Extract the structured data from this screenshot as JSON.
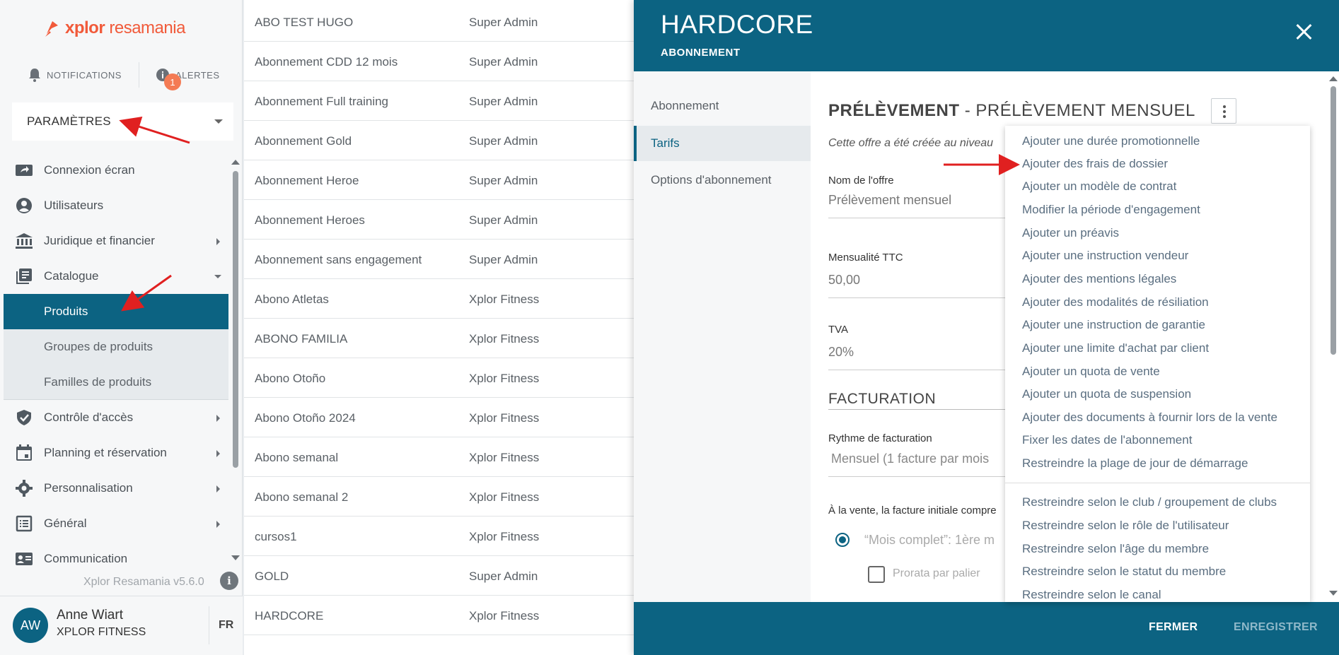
{
  "brand": {
    "name_bold": "xplor",
    "name_rest": " resamania",
    "color": "#f15a3a"
  },
  "header_buttons": {
    "notifications": "NOTIFICATIONS",
    "alerts": "ALERTES",
    "alerts_count": "1"
  },
  "parametres": {
    "label": "PARAMÈTRES"
  },
  "menu": {
    "items": [
      {
        "label": "Connexion écran",
        "icon": "screen-share-icon"
      },
      {
        "label": "Utilisateurs",
        "icon": "user-circle-icon"
      },
      {
        "label": "Juridique et financier",
        "icon": "bank-icon"
      },
      {
        "label": "Catalogue",
        "icon": "catalog-icon"
      },
      {
        "label": "Produits"
      },
      {
        "label": "Groupes de produits"
      },
      {
        "label": "Familles de produits"
      },
      {
        "label": "Contrôle d'accès",
        "icon": "shield-check-icon"
      },
      {
        "label": "Planning et réservation",
        "icon": "calendar-icon"
      },
      {
        "label": "Personnalisation",
        "icon": "gear-icon"
      },
      {
        "label": "Général",
        "icon": "list-icon"
      },
      {
        "label": "Communication",
        "icon": "contact-card-icon"
      }
    ]
  },
  "version": "Xplor Resamania v5.6.0",
  "user": {
    "initials": "AW",
    "name": "Anne Wiart",
    "company": "XPLOR FITNESS",
    "lang": "FR"
  },
  "products": [
    {
      "name": "ABO TEST HUGO",
      "owner": "Super Admin"
    },
    {
      "name": "Abonnement CDD 12 mois",
      "owner": "Super Admin"
    },
    {
      "name": "Abonnement Full training",
      "owner": "Super Admin"
    },
    {
      "name": "Abonnement Gold",
      "owner": "Super Admin"
    },
    {
      "name": "Abonnement Heroe",
      "owner": "Super Admin"
    },
    {
      "name": "Abonnement Heroes",
      "owner": "Super Admin"
    },
    {
      "name": "Abonnement sans engagement",
      "owner": "Super Admin"
    },
    {
      "name": "Abono Atletas",
      "owner": "Xplor Fitness"
    },
    {
      "name": "ABONO FAMILIA",
      "owner": "Xplor Fitness"
    },
    {
      "name": "Abono Otoño",
      "owner": "Xplor Fitness"
    },
    {
      "name": "Abono Otoño 2024",
      "owner": "Xplor Fitness"
    },
    {
      "name": "Abono semanal",
      "owner": "Xplor Fitness"
    },
    {
      "name": "Abono semanal 2",
      "owner": "Xplor Fitness"
    },
    {
      "name": "cursos1",
      "owner": "Xplor Fitness"
    },
    {
      "name": "GOLD",
      "owner": "Super Admin"
    },
    {
      "name": "HARDCORE",
      "owner": "Xplor Fitness"
    }
  ],
  "panel": {
    "title": "HARDCORE",
    "subtitle": "ABONNEMENT",
    "nav": [
      "Abonnement",
      "Tarifs",
      "Options d'abonnement"
    ],
    "section_bold": "PRÉLÈVEMENT",
    "section_rest": " - PRÉLÈVEMENT MENSUEL",
    "note": "Cette offre a été créée au niveau",
    "fields": [
      {
        "label": "Nom de l'offre",
        "value": "Prélèvement mensuel"
      },
      {
        "label": "Mensualité TTC",
        "value": "50,00"
      },
      {
        "label": "TVA",
        "value": "20%"
      }
    ],
    "facturation_title": "FACTURATION",
    "rythme_label": "Rythme de facturation",
    "rythme_value": "Mensuel (1 facture par mois",
    "vente_label": "À la vente, la facture initiale compre",
    "radio_label": "“Mois complet”: 1ère m",
    "checkbox_label": "Prorata par palier",
    "footer": {
      "close": "FERMER",
      "save": "ENREGISTRER"
    }
  },
  "dropdown": {
    "group1": [
      "Ajouter une durée promotionnelle",
      "Ajouter des frais de dossier",
      "Ajouter un modèle de contrat",
      "Modifier la période d'engagement",
      "Ajouter un préavis",
      "Ajouter une instruction vendeur",
      "Ajouter des mentions légales",
      "Ajouter des modalités de résiliation",
      "Ajouter une instruction de garantie",
      "Ajouter une limite d'achat par client",
      "Ajouter un quota de vente",
      "Ajouter un quota de suspension",
      "Ajouter des documents à fournir lors de la vente",
      "Fixer les dates de l'abonnement",
      "Restreindre la plage de jour de démarrage"
    ],
    "group2": [
      "Restreindre selon le club / groupement de clubs",
      "Restreindre selon le rôle de l'utilisateur",
      "Restreindre selon l'âge du membre",
      "Restreindre selon le statut du membre",
      "Restreindre selon le canal"
    ]
  },
  "colors": {
    "primary": "#0c6382",
    "accent": "#f47b54",
    "annotation": "#e02020"
  }
}
